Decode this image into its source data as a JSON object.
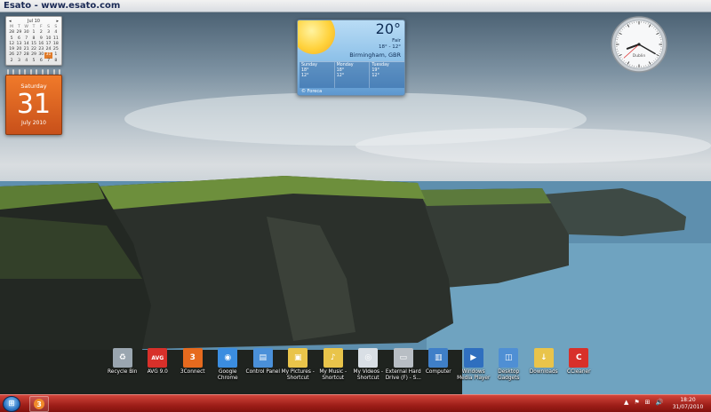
{
  "watermark": {
    "text": "Esato - www.esato.com"
  },
  "calendar_small": {
    "month_label": "Jul 10",
    "weekdays": [
      "M",
      "T",
      "W",
      "T",
      "F",
      "S",
      "S"
    ],
    "weeks": [
      [
        "28",
        "29",
        "30",
        "1",
        "2",
        "3",
        "4"
      ],
      [
        "5",
        "6",
        "7",
        "8",
        "9",
        "10",
        "11"
      ],
      [
        "12",
        "13",
        "14",
        "15",
        "16",
        "17",
        "18"
      ],
      [
        "19",
        "20",
        "21",
        "22",
        "23",
        "24",
        "25"
      ],
      [
        "26",
        "27",
        "28",
        "29",
        "30",
        "31",
        "1"
      ],
      [
        "2",
        "3",
        "4",
        "5",
        "6",
        "7",
        "8"
      ]
    ],
    "today": "31"
  },
  "calendar_big": {
    "day_name": "Saturday",
    "day_number": "31",
    "month_year": "July 2010"
  },
  "weather": {
    "temperature": "20°",
    "condition": "Fair",
    "range": "18° - 12°",
    "city": "Birmingham, GBR",
    "forecast": [
      {
        "day": "Sunday",
        "high": "18°",
        "low": "12°"
      },
      {
        "day": "Monday",
        "high": "18°",
        "low": "12°"
      },
      {
        "day": "Tuesday",
        "high": "19°",
        "low": "12°"
      }
    ],
    "provider": "© Foreca"
  },
  "clock": {
    "label": "Dublin",
    "hour": 8,
    "minute": 20,
    "second": 38
  },
  "desktop_icons": [
    {
      "name": "recycle-bin",
      "label": "Recycle Bin",
      "label2": "",
      "color": "#9aa6b0",
      "glyph": "♻",
      "icon": "recycle-bin-icon"
    },
    {
      "name": "avg",
      "label": "AVG 9.0",
      "label2": "",
      "color": "#d8302a",
      "glyph": "AVG",
      "icon": "avg-icon"
    },
    {
      "name": "3connect",
      "label": "3Connect",
      "label2": "",
      "color": "#e66a1e",
      "glyph": "3",
      "icon": "3connect-icon"
    },
    {
      "name": "google-chrome",
      "label": "Google",
      "label2": "Chrome",
      "color": "#3b8de0",
      "glyph": "◉",
      "icon": "chrome-icon"
    },
    {
      "name": "control-panel",
      "label": "Control Panel",
      "label2": "",
      "color": "#4a90d9",
      "glyph": "▤",
      "icon": "control-panel-icon"
    },
    {
      "name": "my-pictures",
      "label": "My Pictures -",
      "label2": "Shortcut",
      "color": "#e9c44a",
      "glyph": "▣",
      "icon": "folder-icon"
    },
    {
      "name": "my-music",
      "label": "My Music -",
      "label2": "Shortcut",
      "color": "#e9c44a",
      "glyph": "♪",
      "icon": "folder-music-icon"
    },
    {
      "name": "my-videos",
      "label": "My Videos -",
      "label2": "Shortcut",
      "color": "#d9dfe5",
      "glyph": "◎",
      "icon": "dvd-icon"
    },
    {
      "name": "external-drive",
      "label": "External Hard",
      "label2": "Drive (F) - S...",
      "color": "#b8bec4",
      "glyph": "▭",
      "icon": "hard-drive-icon"
    },
    {
      "name": "computer",
      "label": "Computer",
      "label2": "",
      "color": "#3f7fc8",
      "glyph": "▥",
      "icon": "computer-icon"
    },
    {
      "name": "windows-media-player",
      "label": "Windows",
      "label2": "Media Player",
      "color": "#2f6fbf",
      "glyph": "▶",
      "icon": "media-player-icon"
    },
    {
      "name": "desktop-gadgets",
      "label": "Desktop",
      "label2": "Gadgets",
      "color": "#4f8fd4",
      "glyph": "◫",
      "icon": "gadgets-icon"
    },
    {
      "name": "downloads",
      "label": "Downloads",
      "label2": "",
      "color": "#e9c44a",
      "glyph": "↓",
      "icon": "downloads-folder-icon"
    },
    {
      "name": "ccleaner",
      "label": "CCleaner",
      "label2": "",
      "color": "#d8302a",
      "glyph": "C",
      "icon": "ccleaner-icon"
    }
  ],
  "taskbar": {
    "start_icon": "windows-orb-icon",
    "pinned_app": "3",
    "tray_icons": [
      "▲",
      "⚑",
      "⊞",
      "🔊"
    ],
    "time": "18:20",
    "date": "31/07/2010"
  }
}
